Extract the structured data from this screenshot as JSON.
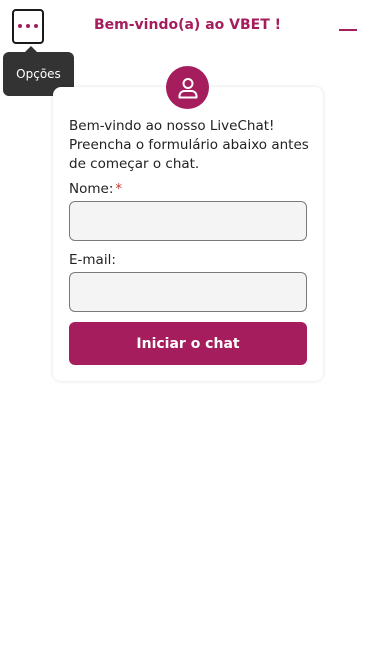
{
  "header": {
    "title": "Bem-vindo(a) ao VBET !",
    "menu_icon": "more-horizontal-icon",
    "minimize_icon": "minimize-icon"
  },
  "tooltip": {
    "text": "Opções"
  },
  "form": {
    "avatar_icon": "user-icon",
    "intro": "Bem-vindo ao nosso LiveChat! Preencha o formulário abaixo antes de começar o chat.",
    "name_label": "Nome:",
    "required_mark": "*",
    "name_value": "",
    "email_label": "E-mail:",
    "email_value": "",
    "submit_label": "Iniciar o chat"
  },
  "colors": {
    "accent": "#a51d5d",
    "tooltip_bg": "#333333",
    "required": "#c0392b",
    "input_bg": "#f4f4f4"
  }
}
